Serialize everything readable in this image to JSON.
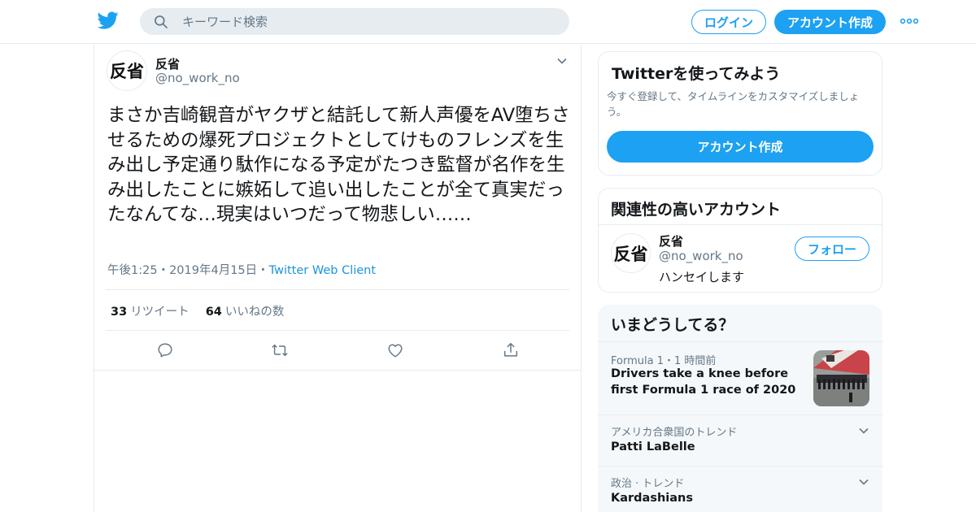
{
  "header": {
    "search_placeholder": "キーワード検索",
    "login_label": "ログイン",
    "signup_label": "アカウント作成",
    "brand_color": "#1da1f2"
  },
  "tweet": {
    "avatar_text": "反省",
    "name": "反省",
    "handle": "@no_work_no",
    "text": "まさか吉崎観音がヤクザと結託して新人声優をAV堕ちさせるための爆死プロジェクトとしてけものフレンズを生み出し予定通り駄作になる予定がたつき監督が名作を生み出したことに嫉妬して追い出したことが全て真実だったなんてな…現実はいつだって物悲しい……",
    "time": "午後1:25",
    "date": "2019年4月15日",
    "separator": "・",
    "client": "Twitter Web Client",
    "retweet_count": "33",
    "retweet_label": "リツイート",
    "like_count": "64",
    "like_label": "いいねの数"
  },
  "signup_card": {
    "title": "Twitterを使ってみよう",
    "description": "今すぐ登録して、タイムラインをカスタマイズしましょう。",
    "button_label": "アカウント作成"
  },
  "related_card": {
    "title": "関連性の高いアカウント",
    "account": {
      "avatar_text": "反省",
      "name": "反省",
      "handle": "@no_work_no",
      "bio": "ハンセイします",
      "follow_label": "フォロー"
    }
  },
  "trends_card": {
    "title": "いまどうしてる？",
    "items": [
      {
        "context": "Formula 1・1 時間前",
        "title": "Drivers take a knee before first Formula 1 race of 2020",
        "has_image": true
      },
      {
        "context": "アメリカ合衆国のトレンド",
        "title": "Patti LaBelle",
        "has_image": false
      },
      {
        "context": "政治 · トレンド",
        "title": "Kardashians",
        "has_image": false
      }
    ]
  }
}
